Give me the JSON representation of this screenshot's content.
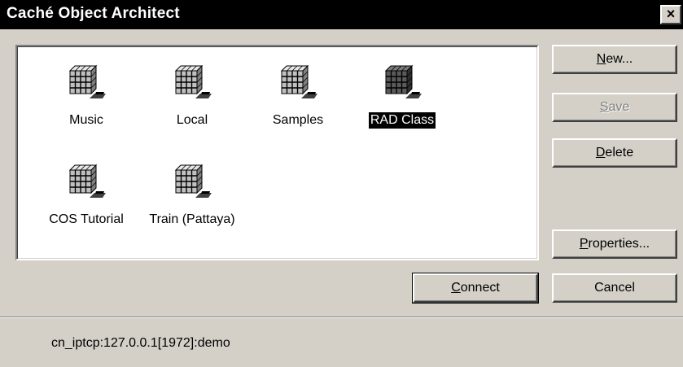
{
  "window": {
    "title": "Caché Object Architect",
    "close_glyph": "×"
  },
  "namespaces": [
    {
      "label": "Music",
      "icon": "database-icon",
      "selected": false
    },
    {
      "label": "Local",
      "icon": "database-icon",
      "selected": false
    },
    {
      "label": "Samples",
      "icon": "database-icon",
      "selected": false
    },
    {
      "label": "RAD Class",
      "icon": "database-icon",
      "selected": true
    },
    {
      "label": "COS Tutorial",
      "icon": "database-icon",
      "selected": false
    },
    {
      "label": "Train (Pattaya)",
      "icon": "database-icon",
      "selected": false
    }
  ],
  "buttons": {
    "new": {
      "accel": "N",
      "rest": "ew..."
    },
    "save": {
      "accel": "S",
      "rest": "ave"
    },
    "delete": {
      "accel": "D",
      "rest": "elete"
    },
    "properties": {
      "accel": "P",
      "rest": "roperties..."
    },
    "connect": {
      "accel": "C",
      "rest": "onnect"
    },
    "cancel": {
      "label": "Cancel"
    }
  },
  "status": {
    "connection": "cn_iptcp:127.0.0.1[1972]:demo"
  },
  "colors": {
    "face": "#d4d0c8",
    "titlebar": "#000000",
    "selection": "#000000"
  }
}
